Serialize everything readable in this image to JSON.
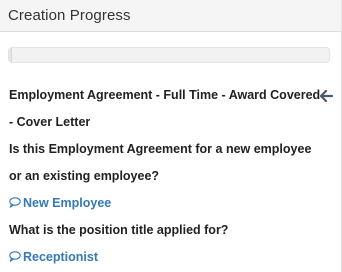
{
  "header": {
    "title": "Creation Progress"
  },
  "progress": {
    "value_percent": 1
  },
  "document": {
    "title_line1": "Employment Agreement - Full Time - Award Covered",
    "title_line2": "- Cover Letter",
    "back_icon": "arrow-left-icon"
  },
  "qa": [
    {
      "question_lines": [
        "Is this Employment Agreement for a new employee",
        "or an existing employee?"
      ],
      "answer": "New Employee",
      "answer_icon": "speech-bubble-icon"
    },
    {
      "question_lines": [
        "What is the position title applied for?"
      ],
      "answer": "Receptionist",
      "answer_icon": "speech-bubble-icon"
    }
  ],
  "colors": {
    "answer_link": "#337ab7",
    "arrow": "#4a5b6a",
    "header_bg": "#f5f5f5"
  }
}
